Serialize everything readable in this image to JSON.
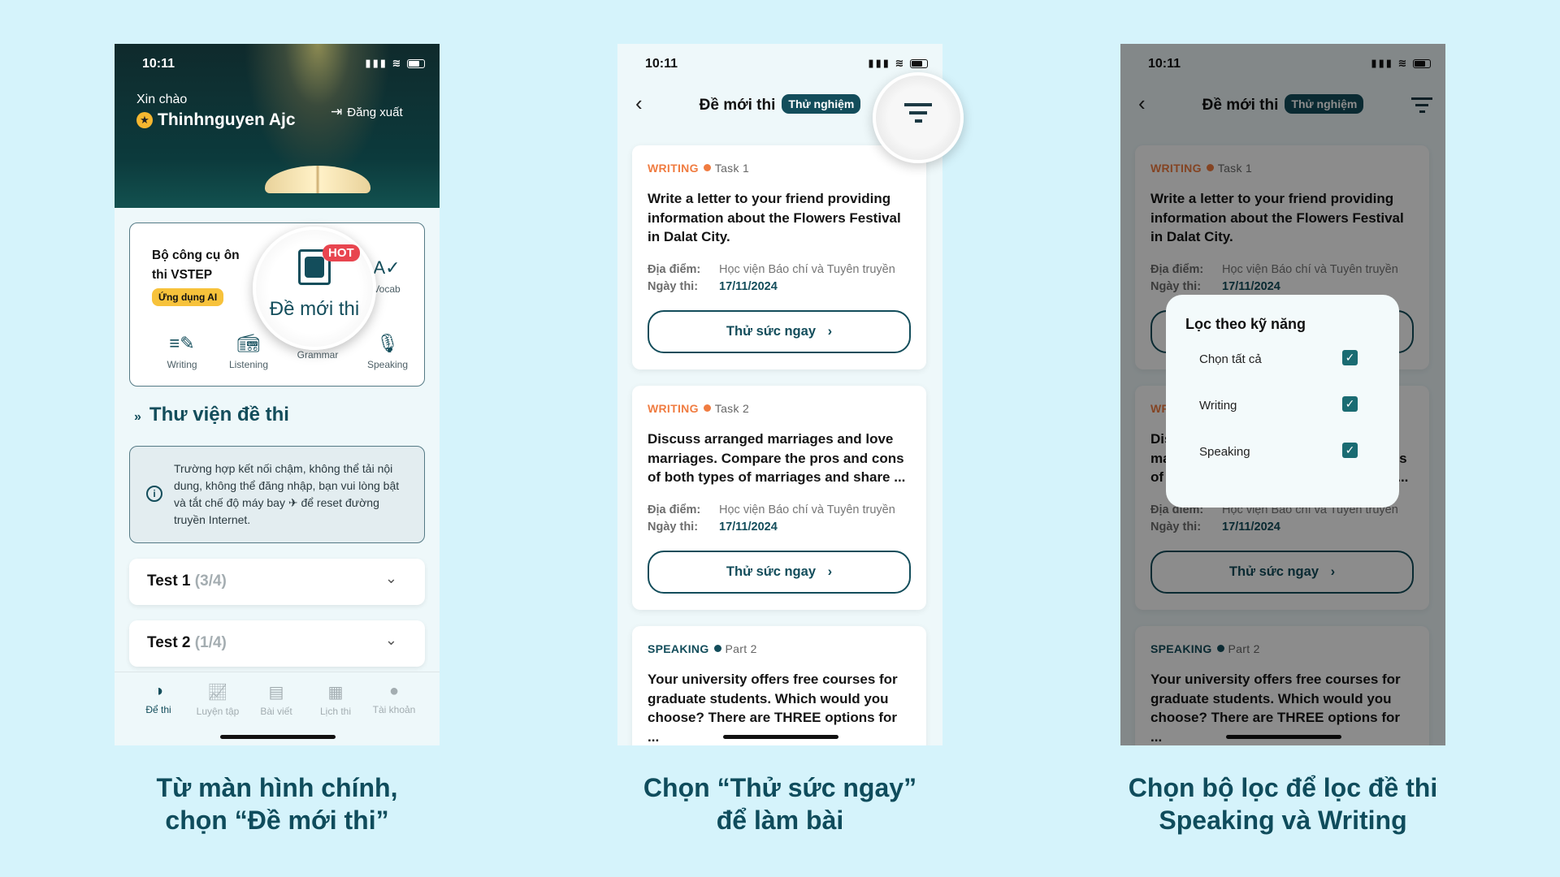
{
  "colors": {
    "background": "#d5f3fb",
    "primary": "#134d5b",
    "writing": "#f07c41",
    "hot": "#e8454f",
    "ai_badge": "#f7c23b"
  },
  "status": {
    "time": "10:11"
  },
  "home": {
    "greeting": "Xin chào",
    "user_name": "Thinhnguyen Ajc",
    "logout": "Đăng xuất",
    "tools_title": "Bộ công cụ ôn thi VSTEP",
    "ai_badge": "Ứng dụng AI",
    "featured": {
      "label": "Đề mới thi",
      "hot": "HOT",
      "icon": "exam-scan-icon"
    },
    "tools": [
      {
        "label": "Vocab",
        "icon": "vocab-icon"
      },
      {
        "label": "Writing",
        "icon": "writing-icon"
      },
      {
        "label": "Listening",
        "icon": "radio-icon"
      },
      {
        "label": "Grammar",
        "icon": "grammar-icon"
      },
      {
        "label": "Speaking",
        "icon": "microphone-icon"
      }
    ],
    "library_title": "Thư viện đề thi",
    "info_text": "Trường hợp kết nối chậm, không thể tải nội dung, không thể đăng nhập, bạn vui lòng bật và tắt chế độ máy bay ✈ để reset đường truyền Internet.",
    "tests": [
      {
        "name": "Test 1",
        "progress": "(3/4)"
      },
      {
        "name": "Test 2",
        "progress": "(1/4)"
      }
    ],
    "nav": [
      {
        "label": "Để thi",
        "icon": "exam-icon",
        "active": true
      },
      {
        "label": "Luyện tập",
        "icon": "practice-icon"
      },
      {
        "label": "Bài viết",
        "icon": "article-icon"
      },
      {
        "label": "Lịch thi",
        "icon": "calendar-icon"
      },
      {
        "label": "Tài khoản",
        "icon": "account-icon"
      }
    ]
  },
  "exams": {
    "title": "Đề mới thi",
    "badge": "Thử nghiệm",
    "location_label": "Địa điểm:",
    "date_label": "Ngày thi:",
    "try_label": "Thử sức ngay",
    "cards": [
      {
        "skill": "WRITING",
        "part": "Task 1",
        "question": "Write a letter to your friend providing information about the Flowers Festival in Dalat City.",
        "location": "Học viện Báo chí và Tuyên truyền",
        "date": "17/11/2024"
      },
      {
        "skill": "WRITING",
        "part": "Task 2",
        "question": "Discuss arranged marriages and love marriages. Compare the pros and cons of both types of marriages and share ...",
        "location": "Học viện Báo chí và Tuyên truyền",
        "date": "17/11/2024"
      },
      {
        "skill": "SPEAKING",
        "part": "Part 2",
        "question": "Your university offers free courses for graduate students. Which would you choose? There are THREE options for ..."
      }
    ]
  },
  "filter": {
    "title": "Lọc theo kỹ năng",
    "options": [
      {
        "label": "Chọn tất cả",
        "checked": true
      },
      {
        "label": "Writing",
        "checked": true
      },
      {
        "label": "Speaking",
        "checked": true
      }
    ]
  },
  "captions": [
    {
      "line1": "Từ màn hình chính,",
      "line2": "chọn “Đề mới thi”"
    },
    {
      "line1": "Chọn “Thử sức ngay”",
      "line2": "để làm bài"
    },
    {
      "line1": "Chọn bộ lọc để lọc đề thi",
      "line2": "Speaking và Writing"
    }
  ]
}
